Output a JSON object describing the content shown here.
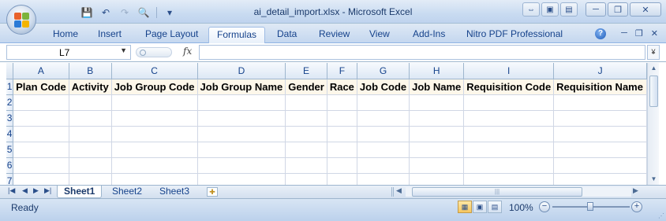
{
  "window": {
    "title": "ai_detail_import.xlsx - Microsoft Excel",
    "minimize_glyph": "─",
    "restore_glyph": "❐",
    "close_glyph": "✕"
  },
  "quick_access": {
    "save_glyph": "💾",
    "undo_glyph": "↶",
    "redo_glyph": "↷",
    "print_preview_glyph": "🔍",
    "customize_glyph": "▾"
  },
  "ribbon": {
    "tabs": [
      "Home",
      "Insert",
      "Page Layout",
      "Formulas",
      "Data",
      "Review",
      "View",
      "Add-Ins",
      "Nitro PDF Professional"
    ],
    "active_tab": "Formulas",
    "help_glyph": "?"
  },
  "formula_bar": {
    "name_box": "L7",
    "fx_label": "fx",
    "formula": ""
  },
  "columns": [
    "A",
    "B",
    "C",
    "D",
    "E",
    "F",
    "G",
    "H",
    "I",
    "J"
  ],
  "rows": [
    {
      "num": "1",
      "cells": [
        "Plan Code",
        "Activity",
        "Job Group Code",
        "Job Group Name",
        "Gender",
        "Race",
        "Job Code",
        "Job Name",
        "Requisition Code",
        "Requisition Name"
      ]
    },
    {
      "num": "2",
      "cells": [
        "",
        "",
        "",
        "",
        "",
        "",
        "",
        "",
        "",
        ""
      ]
    },
    {
      "num": "3",
      "cells": [
        "",
        "",
        "",
        "",
        "",
        "",
        "",
        "",
        "",
        ""
      ]
    },
    {
      "num": "4",
      "cells": [
        "",
        "",
        "",
        "",
        "",
        "",
        "",
        "",
        "",
        ""
      ]
    },
    {
      "num": "5",
      "cells": [
        "",
        "",
        "",
        "",
        "",
        "",
        "",
        "",
        "",
        ""
      ]
    },
    {
      "num": "6",
      "cells": [
        "",
        "",
        "",
        "",
        "",
        "",
        "",
        "",
        "",
        ""
      ]
    },
    {
      "num": "7",
      "cells": [
        "",
        "",
        "",
        "",
        "",
        "",
        "",
        "",
        "",
        ""
      ]
    }
  ],
  "sheets": [
    "Sheet1",
    "Sheet2",
    "Sheet3"
  ],
  "active_sheet": "Sheet1",
  "status": {
    "text": "Ready",
    "zoom": "100%"
  },
  "colors": {
    "accent": "#15428b",
    "ribbon": "#c4d7ef",
    "header_fill": "#fdf7ea"
  }
}
